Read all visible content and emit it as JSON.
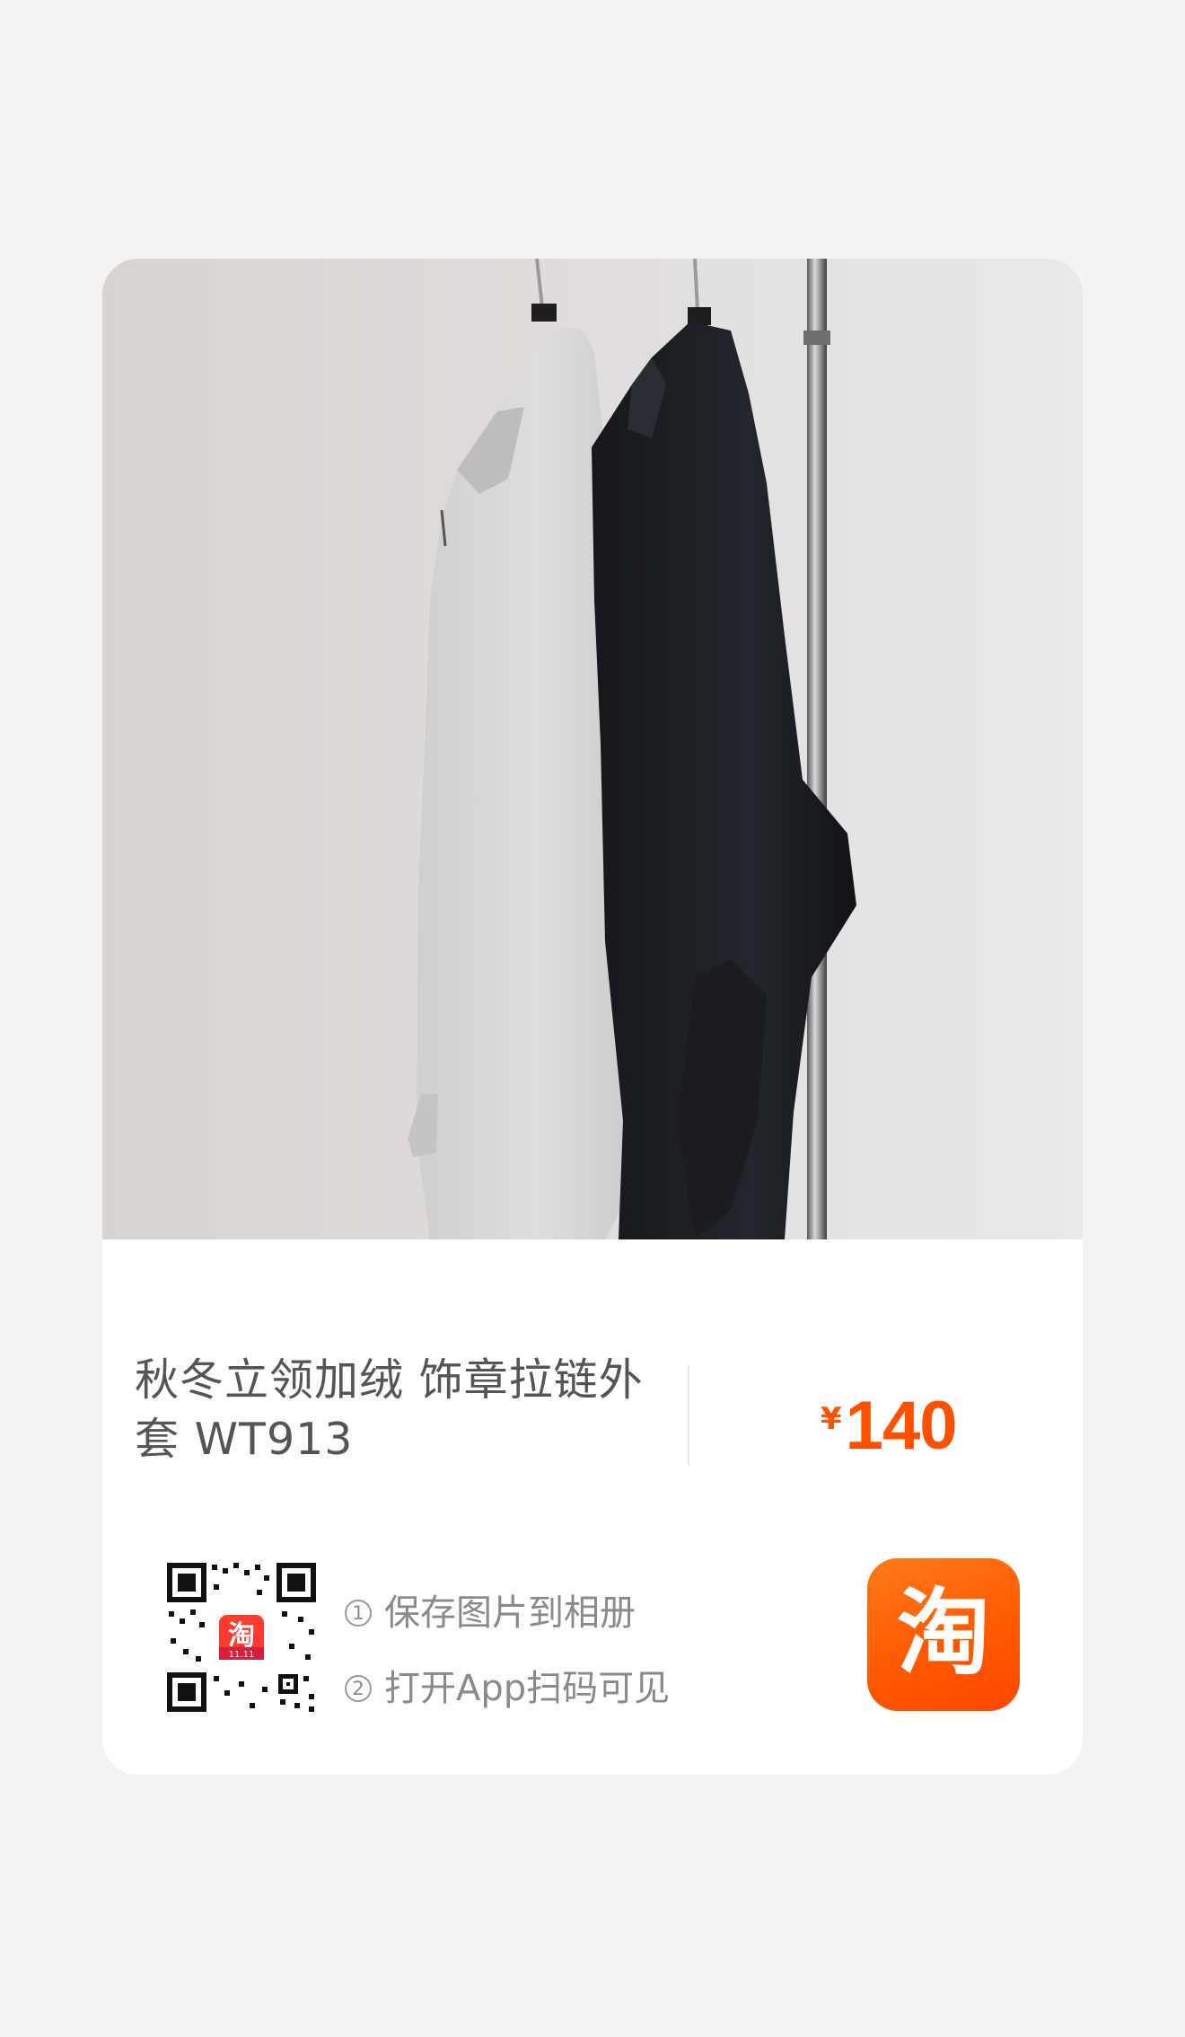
{
  "product": {
    "title": "秋冬立领加绒 饰章拉链外套 WT913",
    "currency_symbol": "¥",
    "price": "140"
  },
  "share": {
    "qr_badge_text": "淘",
    "qr_badge_sub": "11.11",
    "step1_number": "1",
    "step1_label": "保存图片到相册",
    "step2_number": "2",
    "step2_label": "打开App扫码可见"
  },
  "logo": {
    "text": "淘",
    "color": "#ff5000"
  },
  "colors": {
    "accent": "#ff5000",
    "background": "#f3f3f3",
    "card": "#ffffff"
  }
}
